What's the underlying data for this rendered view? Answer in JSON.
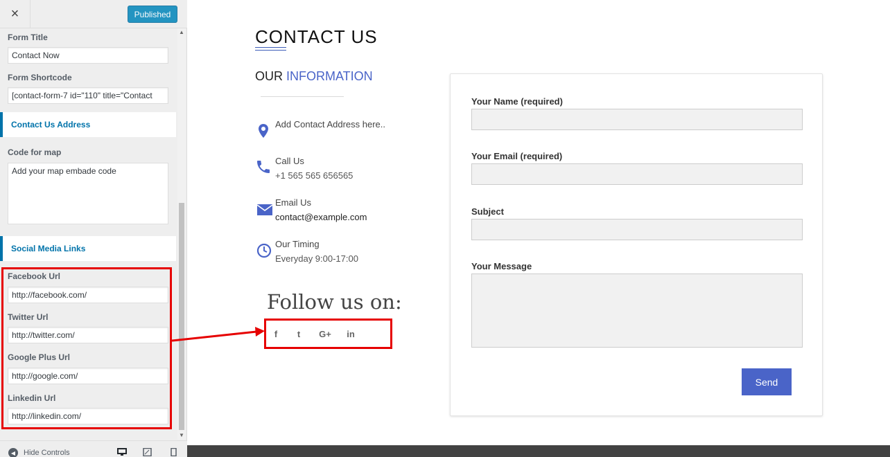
{
  "header": {
    "close_label": "×",
    "publish_label": "Published"
  },
  "sidebar": {
    "form_title_label": "Form Title",
    "form_title_value": "Contact Now",
    "form_shortcode_label": "Form Shortcode",
    "form_shortcode_value": "[contact-form-7 id=\"110\" title=\"Contact",
    "section_address": "Contact Us Address",
    "map_label": "Code for map",
    "map_value": "Add your map embade code",
    "section_social": "Social Media Links",
    "facebook_label": "Facebook Url",
    "facebook_value": "http://facebook.com/",
    "twitter_label": "Twitter Url",
    "twitter_value": "http://twitter.com/",
    "google_label": "Google Plus Url",
    "google_value": "http://google.com/",
    "linkedin_label": "Linkedin Url",
    "linkedin_value": "http://linkedin.com/"
  },
  "footer": {
    "hide_controls": "Hide Controls"
  },
  "preview": {
    "title": "CONTACT US",
    "our": "OUR",
    "information": "INFORMATION",
    "address": "Add Contact Address here..",
    "call_label": "Call Us",
    "call_value": "+1 565 565 656565",
    "email_label": "Email Us",
    "email_value": "contact@example.com",
    "timing_label": "Our Timing",
    "timing_value": "Everyday 9:00-17:00",
    "follow": "Follow us on:",
    "social": [
      "f",
      "t",
      "G+",
      "in"
    ],
    "form": {
      "name_label": "Your Name (required)",
      "email_label": "Your Email (required)",
      "subject_label": "Subject",
      "message_label": "Your Message",
      "send_label": "Send"
    }
  },
  "colors": {
    "accent": "#4a64c8",
    "wp_blue": "#0073aa",
    "publish": "#0085ba",
    "highlight": "#e60000"
  }
}
